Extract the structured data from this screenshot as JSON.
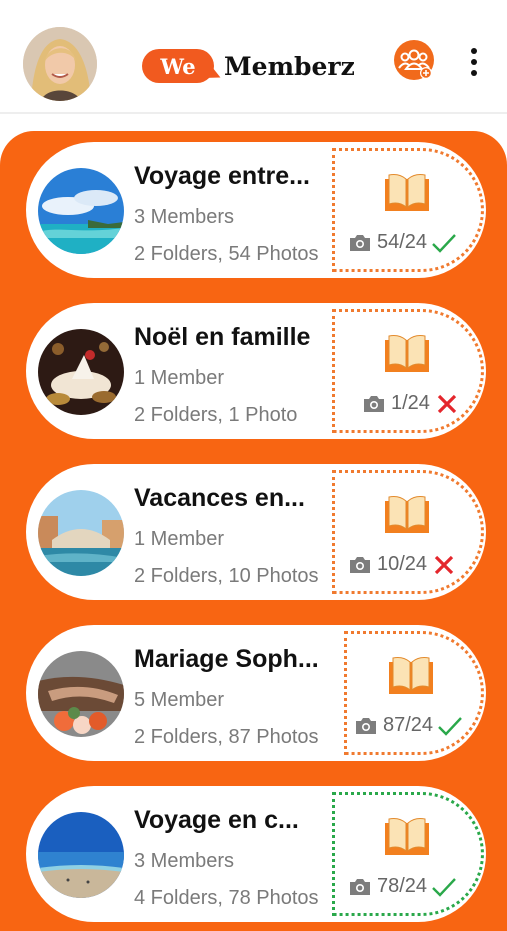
{
  "header": {
    "logo_badge": "We",
    "logo_name": "Memberz"
  },
  "colors": {
    "accent": "#f86512",
    "success": "#2aa84a",
    "error": "#e4262c"
  },
  "groups": [
    {
      "title": "Voyage entre...",
      "members": "3 Members",
      "folders": "2 Folders, 54 Photos",
      "count": "54/24",
      "status": "check",
      "border": "orange"
    },
    {
      "title": "Noël en famille",
      "members": "1 Member",
      "folders": "2 Folders, 1 Photo",
      "count": "1/24",
      "status": "cross",
      "border": "orange"
    },
    {
      "title": "Vacances en...",
      "members": "1 Member",
      "folders": "2 Folders, 10 Photos",
      "count": "10/24",
      "status": "cross",
      "border": "orange"
    },
    {
      "title": "Mariage Soph...",
      "members": "5 Member",
      "folders": "2 Folders, 87 Photos",
      "count": "87/24",
      "status": "check",
      "border": "orange"
    },
    {
      "title": "Voyage en c...",
      "members": "3 Members",
      "folders": "4 Folders, 78 Photos",
      "count": "78/24",
      "status": "check",
      "border": "green"
    }
  ]
}
